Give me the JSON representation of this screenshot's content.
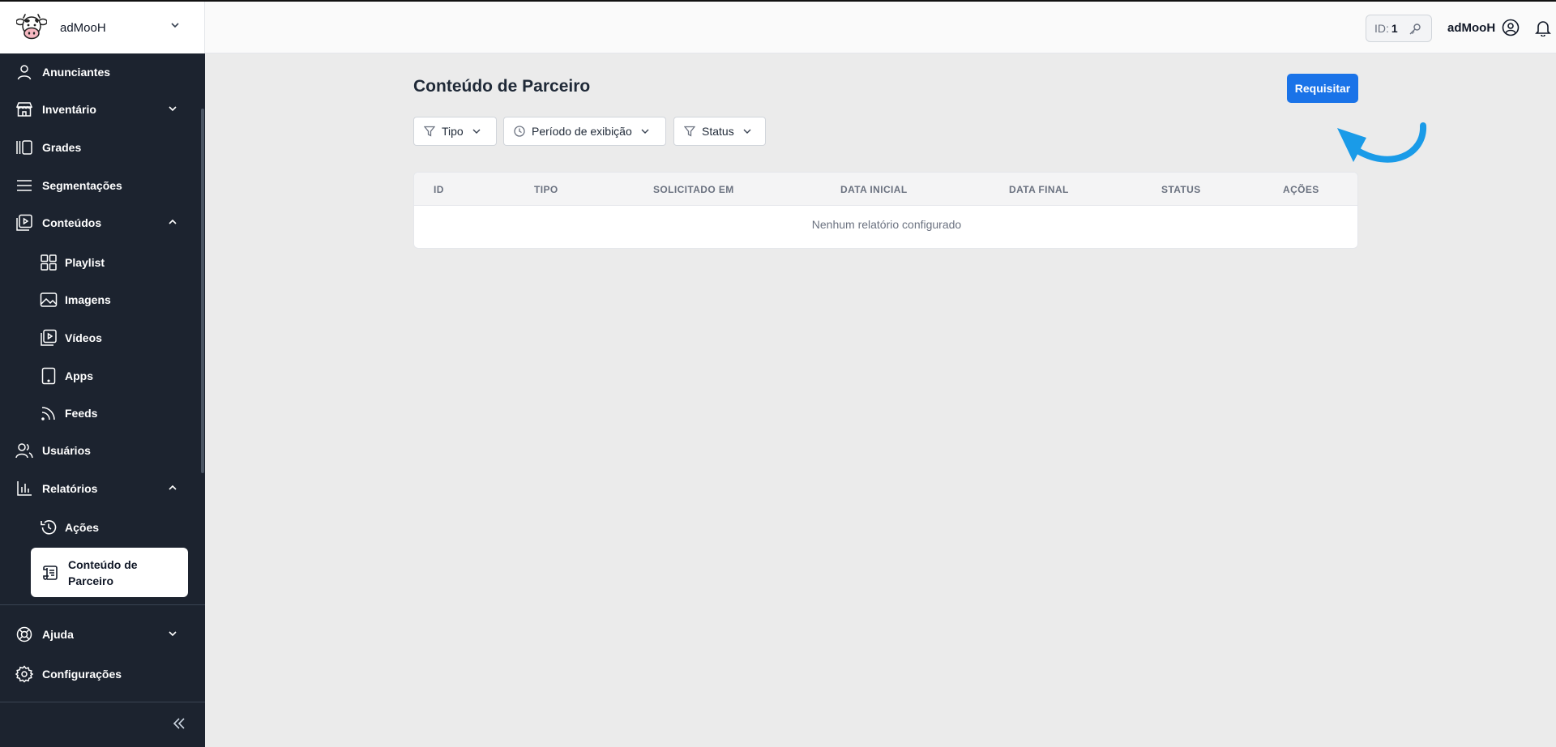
{
  "brand": {
    "name": "adMooH"
  },
  "sidebar": {
    "items": [
      {
        "label": "Anunciantes"
      },
      {
        "label": "Inventário"
      },
      {
        "label": "Grades"
      },
      {
        "label": "Segmentações"
      },
      {
        "label": "Conteúdos"
      },
      {
        "label": "Playlist"
      },
      {
        "label": "Imagens"
      },
      {
        "label": "Vídeos"
      },
      {
        "label": "Apps"
      },
      {
        "label": "Feeds"
      },
      {
        "label": "Usuários"
      },
      {
        "label": "Relatórios"
      },
      {
        "label": "Ações"
      },
      {
        "label": "Conteúdo de Parceiro"
      },
      {
        "label": "Ajuda"
      },
      {
        "label": "Configurações"
      }
    ]
  },
  "header": {
    "id_label": "ID:",
    "id_value": "1",
    "user_name": "adMooH"
  },
  "main": {
    "title": "Conteúdo de Parceiro",
    "request_button": "Requisitar",
    "filters": [
      {
        "label": "Tipo"
      },
      {
        "label": "Período de exibição"
      },
      {
        "label": "Status"
      }
    ],
    "table": {
      "columns": [
        "ID",
        "TIPO",
        "SOLICITADO EM",
        "DATA INICIAL",
        "DATA FINAL",
        "STATUS",
        "AÇÕES"
      ],
      "empty_message": "Nenhum relatório configurado"
    }
  },
  "colors": {
    "sidebar_bg": "#1c232f",
    "accent": "#1a73e8",
    "arrow": "#1a9be8",
    "page_bg": "#ebebeb"
  }
}
